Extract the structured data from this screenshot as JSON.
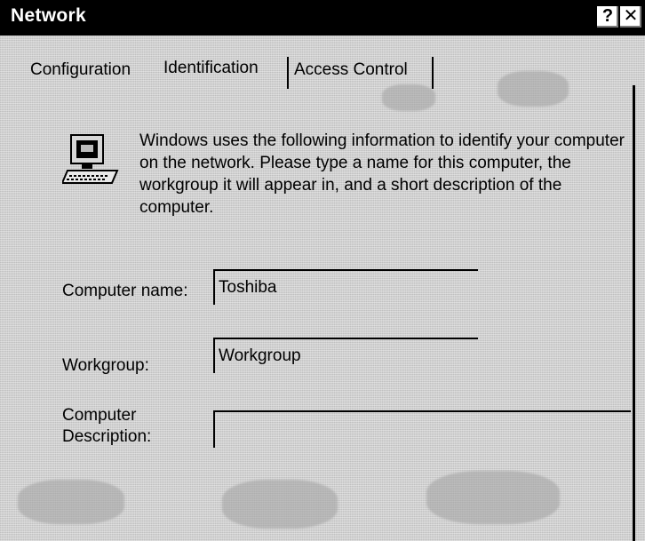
{
  "window": {
    "title": "Network",
    "help_label": "?",
    "close_label": "✕"
  },
  "tabs": [
    {
      "label": "Configuration",
      "selected": false
    },
    {
      "label": "Identification",
      "selected": true
    },
    {
      "label": "Access Control",
      "selected": false
    }
  ],
  "identification": {
    "icon": "computer-icon",
    "info_text": "Windows uses the following information to identify your computer on the network.  Please type a name for this computer, the workgroup it will appear in, and a short description of the computer.",
    "computer_name": {
      "label": "Computer name:",
      "value": "Toshiba"
    },
    "workgroup": {
      "label": "Workgroup:",
      "value": "Workgroup"
    },
    "computer_description": {
      "label_line1": "Computer",
      "label_line2": "Description:",
      "value": ""
    }
  }
}
